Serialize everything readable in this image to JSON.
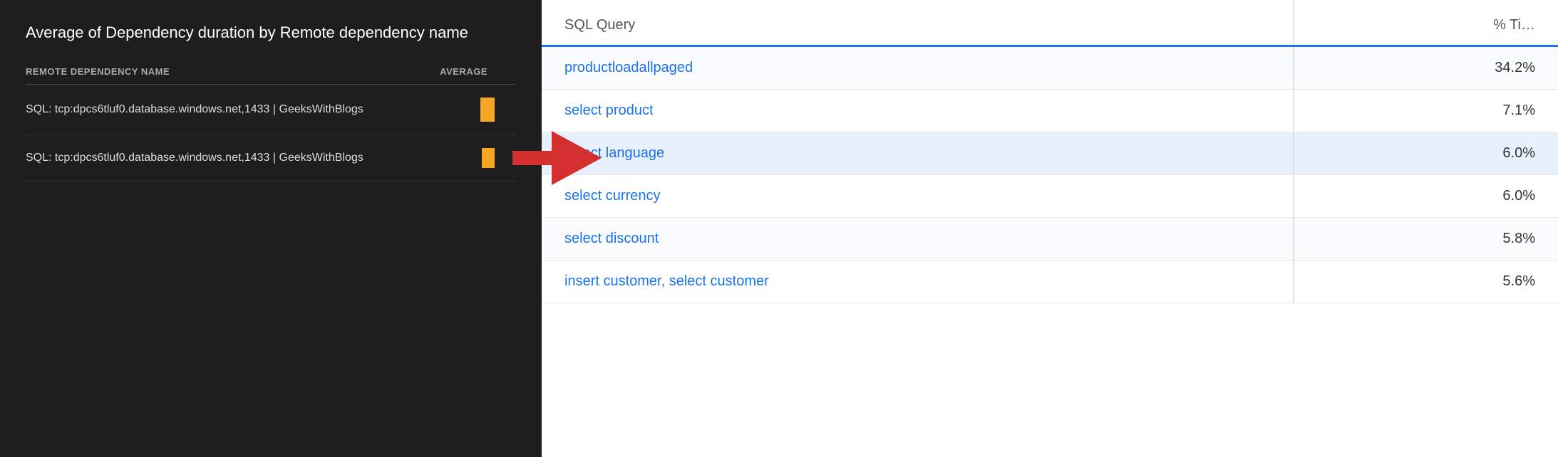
{
  "left": {
    "title": "Average of Dependency duration by Remote dependency name",
    "col_name": "REMOTE DEPENDENCY NAME",
    "col_avg": "AVERAGE",
    "rows": [
      {
        "label": "SQL: tcp:dpcs6tluf0.database.windows.net,1433 | GeeksWithBlogs",
        "bar": "large"
      },
      {
        "label": "SQL: tcp:dpcs6tluf0.database.windows.net,1433 | GeeksWithBlogs",
        "bar": "small"
      }
    ]
  },
  "right": {
    "col_query": "SQL Query",
    "col_pct": "% Ti…",
    "rows": [
      {
        "query": "productloadallpaged",
        "pct": "34.2%",
        "highlighted": false
      },
      {
        "query": "select product",
        "pct": "7.1%",
        "highlighted": false
      },
      {
        "query": "select language",
        "pct": "6.0%",
        "highlighted": true
      },
      {
        "query": "select currency",
        "pct": "6.0%",
        "highlighted": false
      },
      {
        "query": "select discount",
        "pct": "5.8%",
        "highlighted": false
      },
      {
        "query": "insert customer, select customer",
        "pct": "5.6%",
        "highlighted": false
      }
    ]
  }
}
